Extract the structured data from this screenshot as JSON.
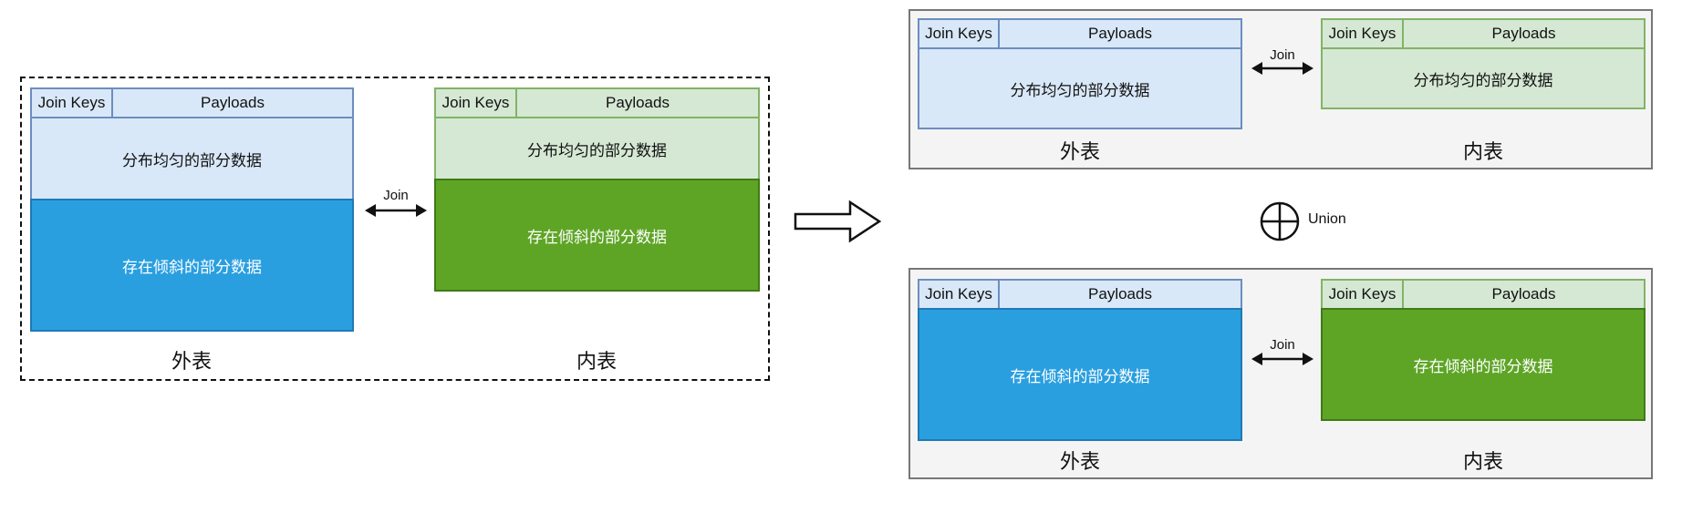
{
  "left_group": {
    "outer": {
      "header_keys": "Join Keys",
      "header_payloads": "Payloads",
      "uniform": "分布均匀的部分数据",
      "skewed": "存在倾斜的部分数据",
      "label": "外表"
    },
    "inner": {
      "header_keys": "Join Keys",
      "header_payloads": "Payloads",
      "uniform": "分布均匀的部分数据",
      "skewed": "存在倾斜的部分数据",
      "label": "内表"
    },
    "join_label": "Join"
  },
  "top_panel": {
    "outer": {
      "header_keys": "Join Keys",
      "header_payloads": "Payloads",
      "body": "分布均匀的部分数据",
      "label": "外表"
    },
    "inner": {
      "header_keys": "Join Keys",
      "header_payloads": "Payloads",
      "body": "分布均匀的部分数据",
      "label": "内表"
    },
    "join_label": "Join"
  },
  "union_label": "Union",
  "bottom_panel": {
    "outer": {
      "header_keys": "Join Keys",
      "header_payloads": "Payloads",
      "body": "存在倾斜的部分数据",
      "label": "外表"
    },
    "inner": {
      "header_keys": "Join Keys",
      "header_payloads": "Payloads",
      "body": "存在倾斜的部分数据",
      "label": "内表"
    },
    "join_label": "Join"
  },
  "colors": {
    "uniform_blue": "#d9e8f8",
    "skew_blue": "#2a9fe0",
    "uniform_green": "#d5e8d4",
    "skew_green": "#5ea526"
  }
}
